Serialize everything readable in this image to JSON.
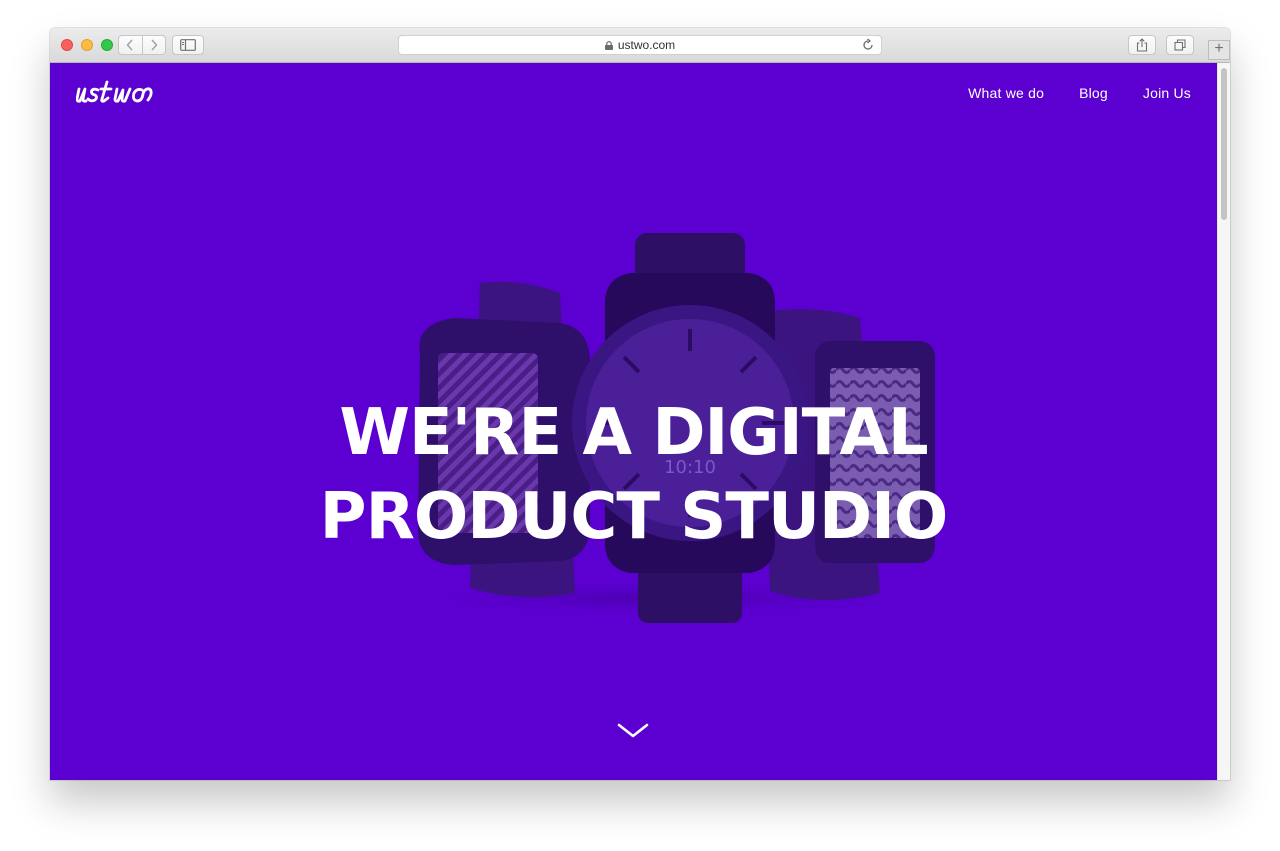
{
  "browser": {
    "address": "ustwo.com"
  },
  "site": {
    "logo_text": "ustwo",
    "nav": [
      {
        "label": "What we do"
      },
      {
        "label": "Blog"
      },
      {
        "label": "Join Us"
      }
    ],
    "hero": {
      "line1": "WE'RE A DIGITAL",
      "line2": "PRODUCT STUDIO",
      "watch_time": "10:10"
    }
  },
  "colors": {
    "brand_purple": "#5b00d0",
    "nav_text": "#ffffff"
  },
  "icons": {
    "scroll": "chevron-down-icon",
    "lock": "lock-icon",
    "reload": "reload-icon"
  }
}
